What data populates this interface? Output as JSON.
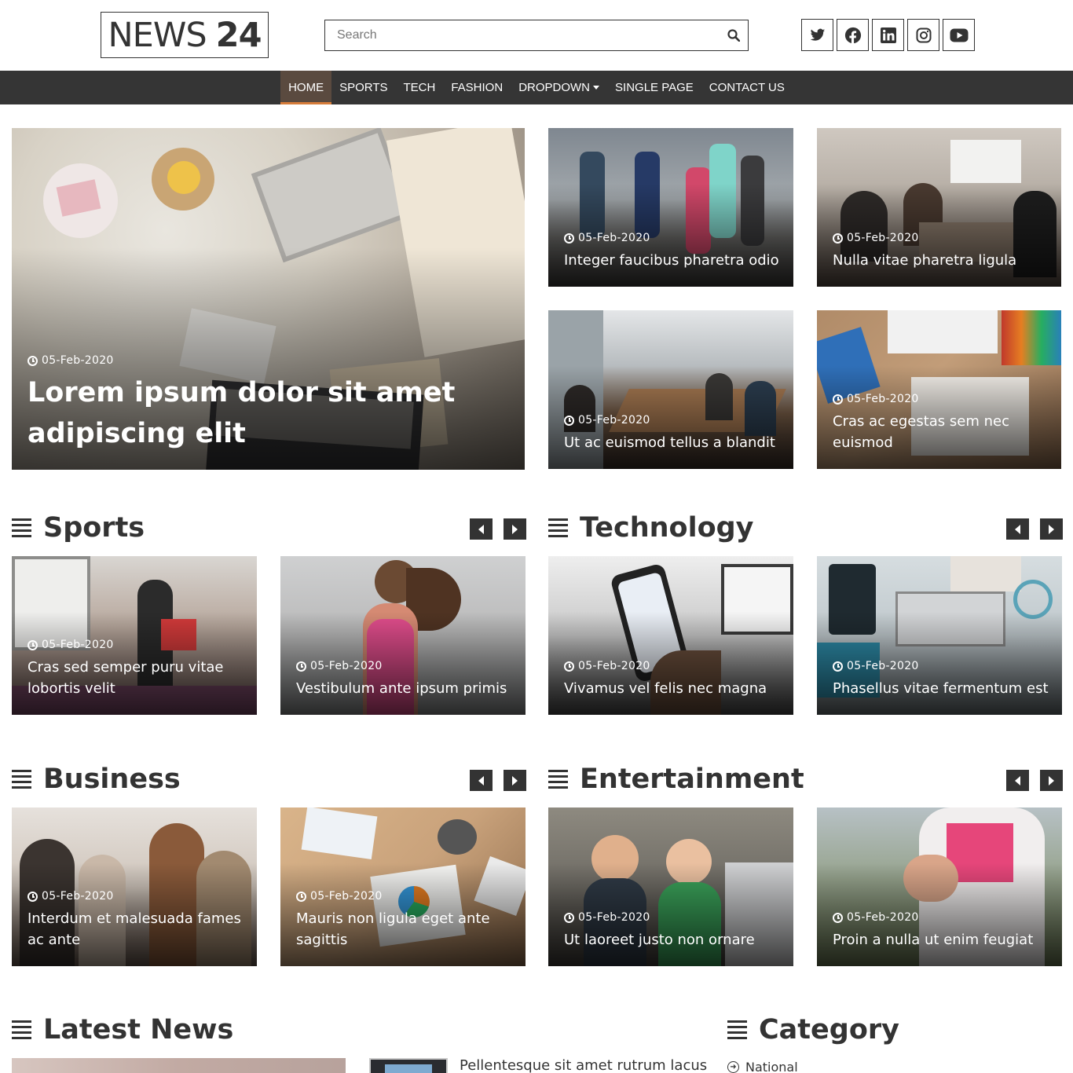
{
  "header": {
    "logo_light": "NEWS",
    "logo_bold": "24",
    "search_placeholder": "Search",
    "social": [
      {
        "icon": "twitter-icon"
      },
      {
        "icon": "facebook-icon"
      },
      {
        "icon": "linkedin-icon"
      },
      {
        "icon": "instagram-icon"
      },
      {
        "icon": "youtube-icon"
      }
    ]
  },
  "nav": {
    "items": [
      "Home",
      "Sports",
      "Tech",
      "Fashion",
      "Dropdown",
      "Single Page",
      "Contact Us"
    ],
    "active": "Home",
    "accent": "#d67c3a",
    "bar_color": "#353535"
  },
  "featured": {
    "main": {
      "date": "05-Feb-2020",
      "title": "Lorem ipsum dolor sit amet adipiscing elit"
    },
    "grid": [
      {
        "date": "05-Feb-2020",
        "title": "Integer faucibus pharetra odio"
      },
      {
        "date": "05-Feb-2020",
        "title": "Nulla vitae pharetra ligula"
      },
      {
        "date": "05-Feb-2020",
        "title": "Ut ac euismod tellus a blandit"
      },
      {
        "date": "05-Feb-2020",
        "title": "Cras ac egestas sem nec euismod"
      }
    ]
  },
  "sections": {
    "sports": {
      "title": "Sports",
      "cards": [
        {
          "date": "05-Feb-2020",
          "title": "Cras sed semper puru vitae lobortis velit"
        },
        {
          "date": "05-Feb-2020",
          "title": "Vestibulum ante ipsum primis"
        }
      ]
    },
    "technology": {
      "title": "Technology",
      "cards": [
        {
          "date": "05-Feb-2020",
          "title": "Vivamus vel felis nec magna"
        },
        {
          "date": "05-Feb-2020",
          "title": "Phasellus vitae fermentum est"
        }
      ]
    },
    "business": {
      "title": "Business",
      "cards": [
        {
          "date": "05-Feb-2020",
          "title": "Interdum et malesuada fames ac ante"
        },
        {
          "date": "05-Feb-2020",
          "title": "Mauris non ligula eget ante sagittis"
        }
      ]
    },
    "entertainment": {
      "title": "Entertainment",
      "cards": [
        {
          "date": "05-Feb-2020",
          "title": "Ut laoreet justo non ornare"
        },
        {
          "date": "05-Feb-2020",
          "title": "Proin a nulla ut enim feugiat"
        }
      ]
    }
  },
  "latest": {
    "title": "Latest News",
    "side_item_title": "Pellentesque sit amet rutrum lacus"
  },
  "category": {
    "title": "Category",
    "items": [
      "National"
    ]
  }
}
